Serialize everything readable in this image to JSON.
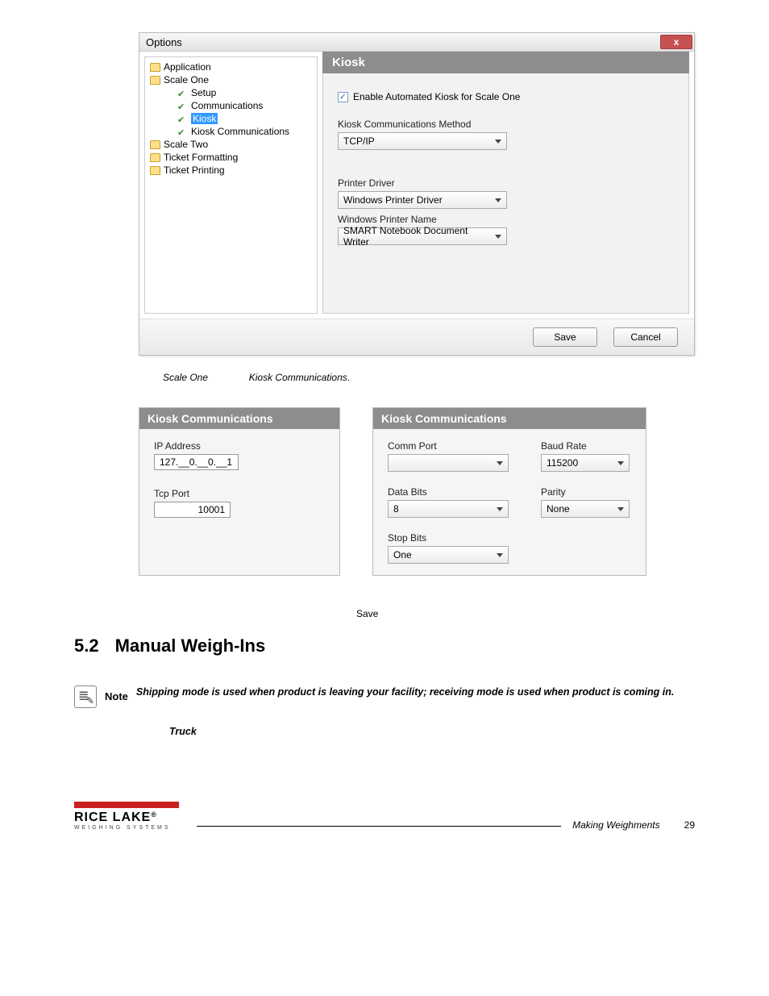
{
  "dialog": {
    "title": "Options",
    "tree": {
      "application": "Application",
      "scale_one": "Scale One",
      "setup": "Setup",
      "communications": "Communications",
      "kiosk": "Kiosk",
      "kiosk_comm": "Kiosk Communications",
      "scale_two": "Scale Two",
      "ticket_formatting": "Ticket Formatting",
      "ticket_printing": "Ticket Printing"
    },
    "panel": {
      "title": "Kiosk",
      "enable_label": "Enable Automated Kiosk for Scale One",
      "method_label": "Kiosk Communications Method",
      "method_value": "TCP/IP",
      "driver_label": "Printer Driver",
      "driver_value": "Windows Printer Driver",
      "printer_name_label": "Windows Printer Name",
      "printer_name_value": "SMART Notebook Document Writer"
    },
    "save": "Save",
    "cancel": "Cancel"
  },
  "caption": {
    "scale_one": "Scale One",
    "kiosk_comm": "Kiosk  Communications",
    "period": "."
  },
  "panelA": {
    "title": "Kiosk Communications",
    "ip_label": "IP Address",
    "ip_value": "127.__0.__0.__1",
    "tcp_label": "Tcp Port",
    "tcp_value": "10001"
  },
  "panelB": {
    "title": "Kiosk Communications",
    "comm_port_label": "Comm Port",
    "comm_port_value": "",
    "baud_label": "Baud Rate",
    "baud_value": "115200",
    "databits_label": "Data Bits",
    "databits_value": "8",
    "parity_label": "Parity",
    "parity_value": "None",
    "stopbits_label": "Stop Bits",
    "stopbits_value": "One"
  },
  "save_word": "Save",
  "section": {
    "num": "5.2",
    "title": "Manual Weigh-Ins"
  },
  "note": {
    "label": "Note",
    "text": "Shipping mode is used when product is leaving your facility; receiving mode is used when product is coming in."
  },
  "truck": "Truck",
  "footer": {
    "logo_main": "RICE LAKE",
    "logo_sub": "WEIGHING SYSTEMS",
    "section_name": "Making Weighments",
    "page": "29"
  }
}
